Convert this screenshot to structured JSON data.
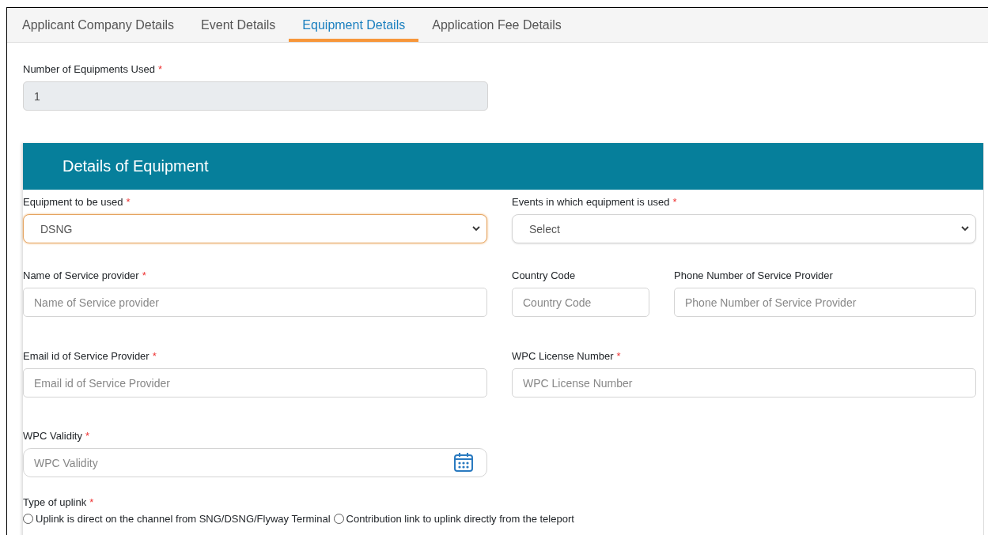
{
  "tabs": [
    {
      "label": "Applicant Company Details",
      "selected": false
    },
    {
      "label": "Event Details",
      "selected": false
    },
    {
      "label": "Equipment Details",
      "selected": true
    },
    {
      "label": "Application Fee Details",
      "selected": false
    }
  ],
  "count_field": {
    "label": "Number of Equipments Used",
    "required_mark": "*",
    "value": "1",
    "disabled": true
  },
  "panel": {
    "title": "Details of Equipment",
    "rows": [
      {
        "columns": [
          [
            {
              "kind": "select",
              "label": "Equipment to be used",
              "required_mark": "*",
              "value": "DSNG",
              "focused": true
            }
          ],
          [
            {
              "kind": "select",
              "label": "Events in which equipment is used",
              "required_mark": "*",
              "value": "Select",
              "focused": false
            }
          ]
        ]
      },
      {
        "columns": [
          [
            {
              "kind": "text",
              "label": "Name of Service provider",
              "required_mark": "*",
              "placeholder": "Name of Service provider"
            }
          ],
          [
            {
              "kind": "text",
              "label": "Country Code",
              "placeholder": "Country Code"
            },
            {
              "kind": "text",
              "label": "Phone Number of Service Provider",
              "placeholder": "Phone Number of Service Provider"
            }
          ]
        ]
      },
      {
        "columns": [
          [
            {
              "kind": "text",
              "label": "Email id of Service Provider",
              "required_mark": "*",
              "placeholder": "Email id of Service Provider"
            }
          ],
          [
            {
              "kind": "text",
              "label": "WPC License Number",
              "required_mark": "*",
              "placeholder": "WPC License Number"
            }
          ]
        ]
      },
      {
        "columns": [
          [
            {
              "kind": "date",
              "label": "WPC Validity",
              "required_mark": "*",
              "placeholder": "WPC Validity"
            }
          ],
          []
        ]
      }
    ],
    "uplink": {
      "label": "Type of uplink",
      "required_mark": "*",
      "options": [
        {
          "label": "Uplink is direct on the channel from SNG/DSNG/Flyway Terminal",
          "selected": false
        },
        {
          "label": "Contribution link to uplink directly from the teleport",
          "selected": false
        }
      ]
    }
  }
}
